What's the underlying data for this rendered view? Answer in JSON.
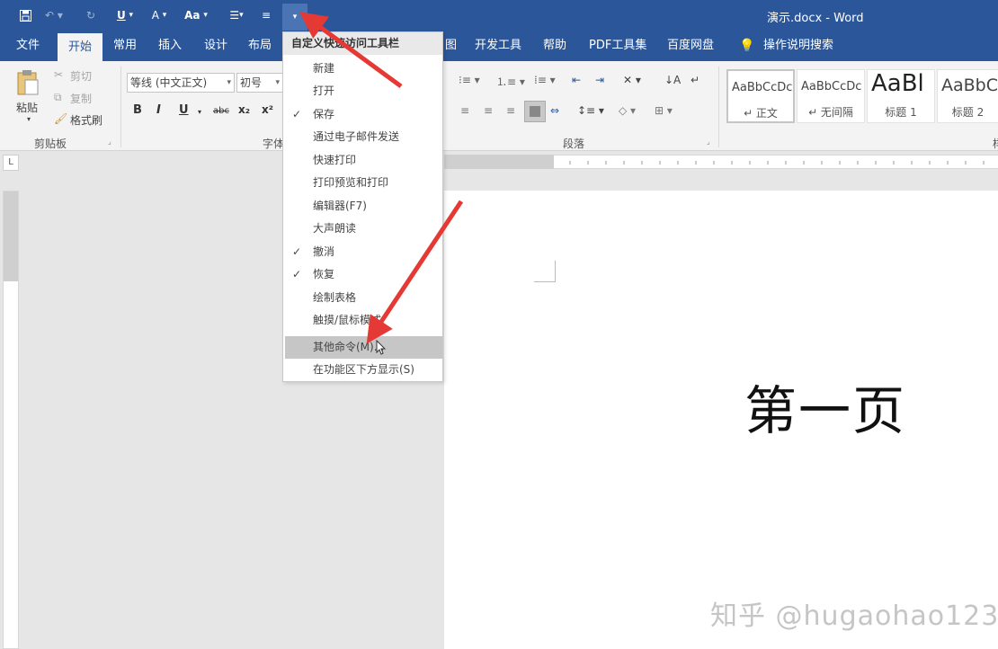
{
  "title_bar": {
    "doc_title": "演示.docx - Word"
  },
  "quick_access": {
    "underline": "U",
    "font_color": "A",
    "change_case": "Aa"
  },
  "tabs": [
    "文件",
    "开始",
    "常用",
    "插入",
    "设计",
    "布局",
    "图",
    "开发工具",
    "帮助",
    "PDF工具集",
    "百度网盘",
    "操作说明搜索"
  ],
  "ribbon": {
    "clipboard": {
      "paste": "粘贴",
      "cut": "剪切",
      "copy": "复制",
      "format_painter": "格式刷",
      "group_label": "剪贴板"
    },
    "font": {
      "font_name": "等线 (中文正文)",
      "font_size": "初号",
      "bold": "B",
      "italic": "I",
      "underline": "U",
      "strike": "abc",
      "subscript": "x₂",
      "superscript": "x²",
      "group_label": "字体"
    },
    "paragraph": {
      "group_label": "段落"
    },
    "styles": [
      {
        "preview": "AaBbCcDc",
        "name": "↵ 正文"
      },
      {
        "preview": "AaBbCcDc",
        "name": "↵ 无间隔"
      },
      {
        "preview": "AaBl",
        "name": "标题 1"
      },
      {
        "preview": "AaBbC",
        "name": "标题 2"
      }
    ],
    "styles_group_label_fragment": "样"
  },
  "ruler": {
    "corner": "L"
  },
  "qa_menu": {
    "title": "自定义快速访问工具栏",
    "items": [
      {
        "label": "新建",
        "checked": false
      },
      {
        "label": "打开",
        "checked": false
      },
      {
        "label": "保存",
        "checked": true
      },
      {
        "label": "通过电子邮件发送",
        "checked": false
      },
      {
        "label": "快速打印",
        "checked": false
      },
      {
        "label": "打印预览和打印",
        "checked": false
      },
      {
        "label": "编辑器(F7)",
        "checked": false
      },
      {
        "label": "大声朗读",
        "checked": false
      },
      {
        "label": "撤消",
        "checked": true
      },
      {
        "label": "恢复",
        "checked": true
      },
      {
        "label": "绘制表格",
        "checked": false
      },
      {
        "label": "触摸/鼠标模式",
        "checked": false
      },
      {
        "label": "其他命令(M)...",
        "checked": false,
        "highlighted": true
      },
      {
        "label": "在功能区下方显示(S)",
        "checked": false
      }
    ],
    "check_glyph": "✓"
  },
  "document": {
    "heading": "第一页"
  },
  "watermark": "知乎 @hugaohao123",
  "colors": {
    "accent": "#2b579a",
    "arrow": "#e53935"
  }
}
